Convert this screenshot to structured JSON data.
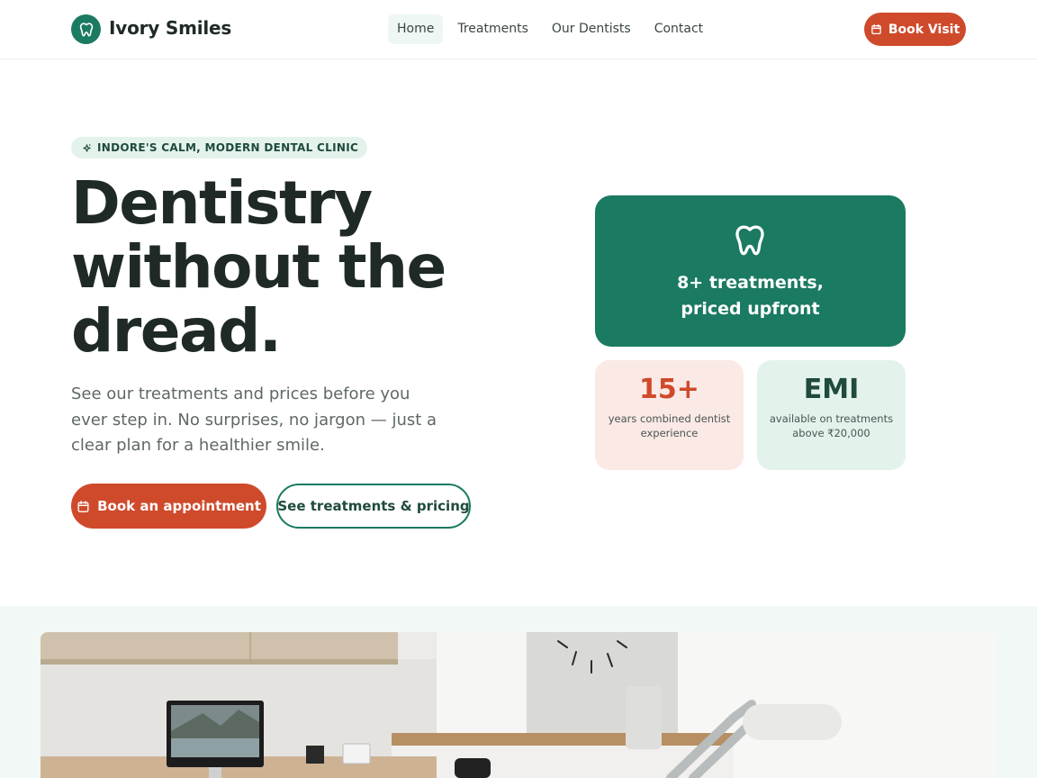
{
  "brand": {
    "name": "Ivory Smiles",
    "logo_icon": "tooth-icon",
    "color": "#1a7a62"
  },
  "nav": {
    "links": [
      {
        "label": "Home",
        "active": true
      },
      {
        "label": "Treatments",
        "active": false
      },
      {
        "label": "Our Dentists",
        "active": false
      },
      {
        "label": "Contact",
        "active": false
      }
    ],
    "cta": {
      "label": "Book Visit",
      "icon": "calendar-icon",
      "color": "#cf4a2b"
    }
  },
  "hero": {
    "badge": {
      "icon": "sparkle-icon",
      "label": "INDORE'S CALM, MODERN DENTAL CLINIC"
    },
    "title_lines": [
      "Dentistry",
      "without the",
      "dread."
    ],
    "subtitle": "See our treatments and prices before you ever step in. No surprises, no jargon — just a clear plan for a healthier smile.",
    "primary_button": {
      "label": "Book an appointment",
      "icon": "calendar-icon"
    },
    "secondary_button": {
      "label": "See treatments & pricing"
    }
  },
  "cards": {
    "main": {
      "icon": "tooth-icon",
      "line1": "8+ treatments,",
      "line2": "priced upfront",
      "color": "#1a7a62"
    },
    "years": {
      "value": "15+",
      "label": "years combined dentist experience",
      "color": "#cf4a2b"
    },
    "emi": {
      "value": "EMI",
      "label": "available on treatments above ₹20,000",
      "color": "#1f4a3c"
    }
  },
  "photo": {
    "subject": "clinic-interior-image"
  }
}
